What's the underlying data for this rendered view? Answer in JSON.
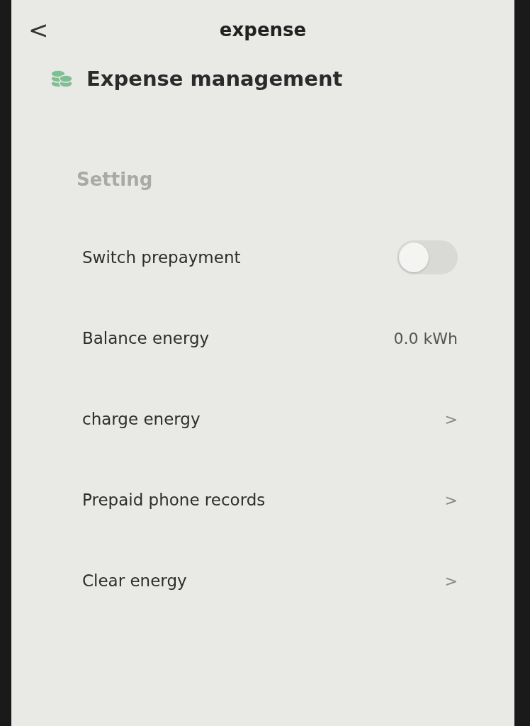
{
  "header": {
    "back": "<",
    "title": "expense"
  },
  "section": {
    "title": "Expense management"
  },
  "group": {
    "title": "Setting"
  },
  "rows": [
    {
      "kind": "toggle",
      "label": "Switch prepayment",
      "on": false
    },
    {
      "kind": "value",
      "label": "Balance energy",
      "value": "0.0 kWh"
    },
    {
      "kind": "link",
      "label": "charge energy",
      "chevron": ">"
    },
    {
      "kind": "link",
      "label": "Prepaid phone records",
      "chevron": ">"
    },
    {
      "kind": "link",
      "label": "Clear energy",
      "chevron": ">"
    }
  ]
}
